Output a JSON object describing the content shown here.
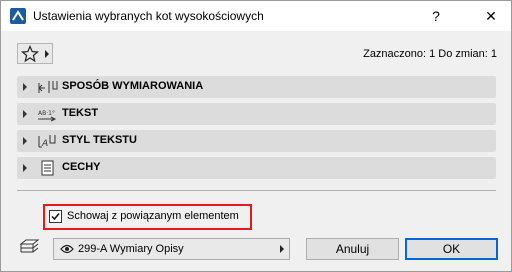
{
  "window": {
    "title": "Ustawienia wybranych kot wysokościowych",
    "help_label": "?",
    "close_label": "✕"
  },
  "toolbar": {
    "favorites_icon": "star-icon",
    "selection_info": "Zaznaczono: 1 Do zmian: 1"
  },
  "panels": [
    {
      "label": "SPOSÓB WYMIAROWANIA",
      "icon": "dimension-method-icon"
    },
    {
      "label": "TEKST",
      "icon": "text-icon"
    },
    {
      "label": "STYL TEKSTU",
      "icon": "text-style-icon"
    },
    {
      "label": "CECHY",
      "icon": "properties-icon"
    }
  ],
  "options": {
    "hide_with_element_label": "Schowaj z powiązanym elementem",
    "hide_with_element_checked": true
  },
  "footer": {
    "layer_value": "299-A Wymiary Opisy",
    "cancel_label": "Anuluj",
    "ok_label": "OK"
  },
  "colors": {
    "highlight_frame": "#e21b1b",
    "ok_border": "#0a64d6"
  }
}
